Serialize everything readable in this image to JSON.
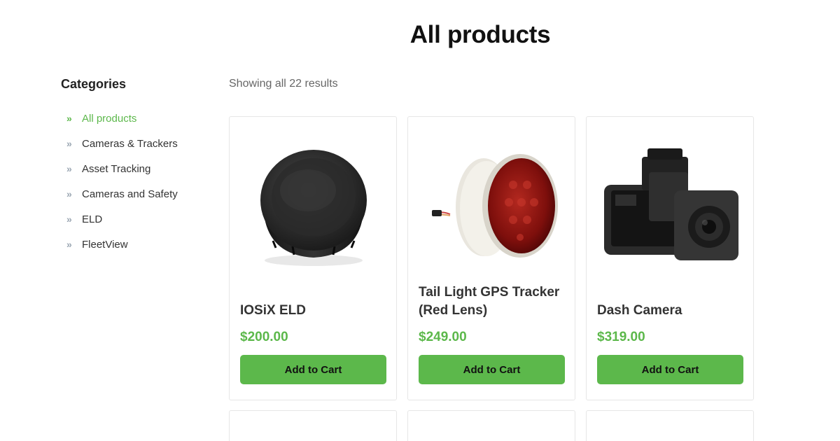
{
  "page": {
    "title": "All products"
  },
  "sidebar": {
    "heading": "Categories",
    "items": [
      {
        "label": "All products",
        "active": true
      },
      {
        "label": "Cameras & Trackers",
        "active": false
      },
      {
        "label": "Asset Tracking",
        "active": false
      },
      {
        "label": "Cameras and Safety",
        "active": false
      },
      {
        "label": "ELD",
        "active": false
      },
      {
        "label": "FleetView",
        "active": false
      }
    ]
  },
  "results_text": "Showing all 22 results",
  "products": [
    {
      "title": "IOSiX ELD",
      "price": "$200.00",
      "button": "Add to Cart",
      "image_icon": "eld-device-image"
    },
    {
      "title": "Tail Light GPS Tracker (Red Lens)",
      "price": "$249.00",
      "button": "Add to Cart",
      "image_icon": "tail-light-image"
    },
    {
      "title": "Dash Camera",
      "price": "$319.00",
      "button": "Add to Cart",
      "image_icon": "dash-camera-image"
    }
  ],
  "colors": {
    "accent": "#5cb84b",
    "chevron": "#9aa6b2",
    "card_border": "#e6e6e6"
  }
}
